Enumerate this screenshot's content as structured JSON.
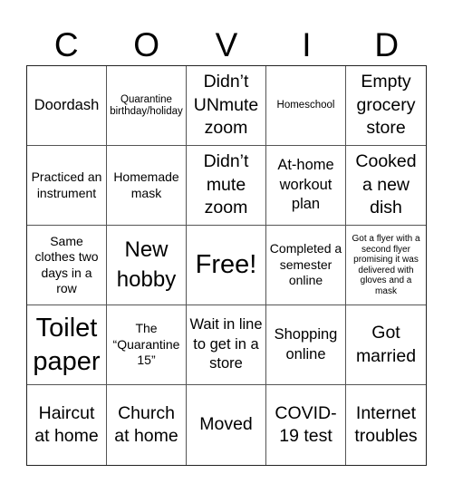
{
  "header": {
    "letters": [
      "C",
      "O",
      "V",
      "I",
      "D"
    ]
  },
  "cells": [
    {
      "text": "Doordash",
      "size": "s-lg"
    },
    {
      "text": "Quarantine birthday/holiday",
      "size": "s-sm"
    },
    {
      "text": "Didn’t UNmute zoom",
      "size": "s-xl"
    },
    {
      "text": "Homeschool",
      "size": "s-sm"
    },
    {
      "text": "Empty grocery store",
      "size": "s-xl"
    },
    {
      "text": "Practiced an instrument",
      "size": "s-md"
    },
    {
      "text": "Homemade mask",
      "size": "s-md"
    },
    {
      "text": "Didn’t mute zoom",
      "size": "s-xl"
    },
    {
      "text": "At-home workout plan",
      "size": "s-lg"
    },
    {
      "text": "Cooked a new dish",
      "size": "s-xl"
    },
    {
      "text": "Same clothes two days in a row",
      "size": "s-md"
    },
    {
      "text": "New hobby",
      "size": "s-xxl"
    },
    {
      "text": "Free!",
      "size": "s-huge"
    },
    {
      "text": "Completed a semester online",
      "size": "s-md"
    },
    {
      "text": "Got a flyer with a second flyer promising it was delivered with gloves and a mask",
      "size": "s-xs"
    },
    {
      "text": "Toilet paper",
      "size": "s-huge"
    },
    {
      "text": "The “Quarantine 15”",
      "size": "s-md"
    },
    {
      "text": "Wait in line to get in a store",
      "size": "s-lg"
    },
    {
      "text": "Shopping online",
      "size": "s-lg"
    },
    {
      "text": "Got married",
      "size": "s-xl"
    },
    {
      "text": "Haircut at home",
      "size": "s-xl"
    },
    {
      "text": "Church at home",
      "size": "s-xl"
    },
    {
      "text": "Moved",
      "size": "s-xl"
    },
    {
      "text": "COVID-19 test",
      "size": "s-xl"
    },
    {
      "text": "Internet troubles",
      "size": "s-xl"
    }
  ]
}
